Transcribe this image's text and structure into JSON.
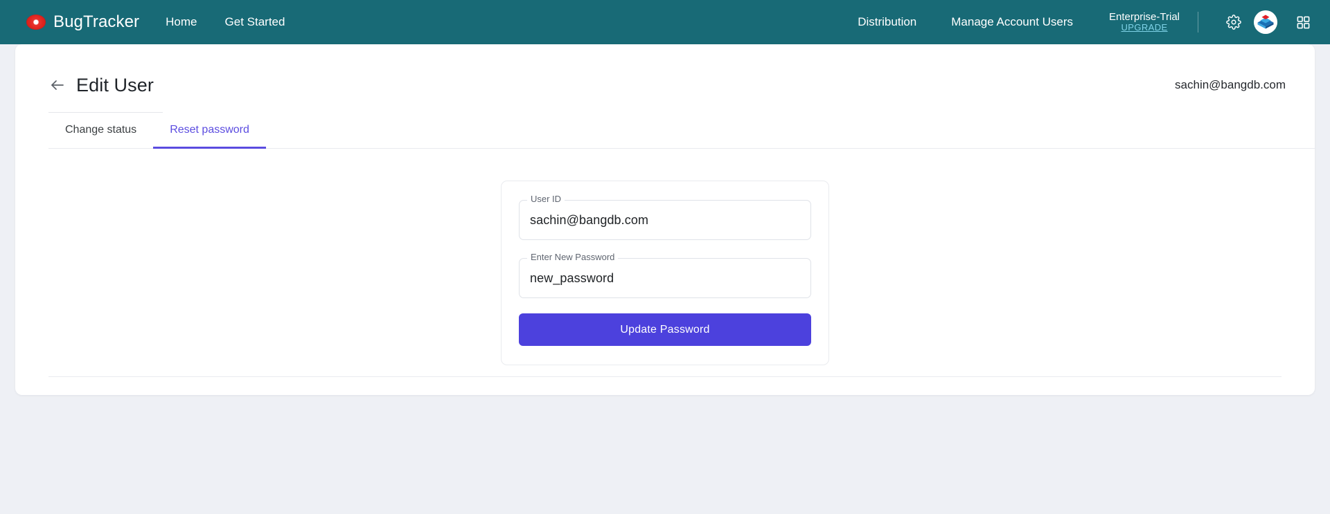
{
  "topnav": {
    "brand": {
      "logo_icon": "bug-eye-logo-icon",
      "name": "BugTracker"
    },
    "left_links": [
      {
        "label": "Home",
        "name": "nav-link-home"
      },
      {
        "label": "Get Started",
        "name": "nav-link-get-started"
      }
    ],
    "right_links": [
      {
        "label": "Distribution",
        "name": "nav-link-distribution"
      },
      {
        "label": "Manage Account Users",
        "name": "nav-link-manage-account-users"
      }
    ],
    "plan": {
      "name": "Enterprise-Trial",
      "upgrade_label": "UPGRADE"
    },
    "icons": {
      "settings": "gear-icon",
      "app_logo": "bangdb-logo-icon",
      "apps_grid": "apps-grid-icon"
    },
    "colors": {
      "background": "#186a76",
      "upgrade_link": "#7fd3e8"
    }
  },
  "page": {
    "back_icon": "back-arrow-icon",
    "title": "Edit User",
    "account_email": "sachin@bangdb.com"
  },
  "tabs": [
    {
      "label": "Change status",
      "name": "tab-change-status",
      "active": false
    },
    {
      "label": "Reset password",
      "name": "tab-reset-password",
      "active": true
    }
  ],
  "form": {
    "user_id": {
      "label": "User ID",
      "value": "sachin@bangdb.com",
      "placeholder": "User ID"
    },
    "new_password": {
      "label": "Enter New Password",
      "value": "new_password",
      "placeholder": "Enter New Password"
    },
    "submit_label": "Update Password",
    "accent_color": "#4c41dd"
  }
}
